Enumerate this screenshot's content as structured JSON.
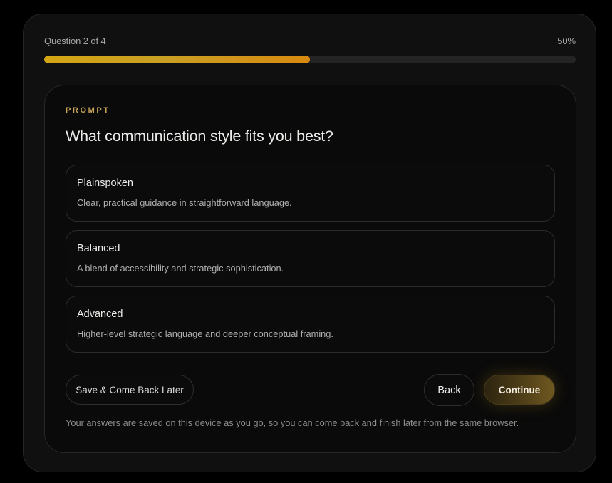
{
  "progress": {
    "label": "Question 2 of 4",
    "percent_label": "50%",
    "fraction": 0.5,
    "colors": {
      "fill_start": "#d4a514",
      "fill_end": "#d88a10",
      "track": "#242424"
    }
  },
  "question": {
    "eyebrow": "PROMPT",
    "text": "What communication style fits you best?",
    "options": [
      {
        "title": "Plainspoken",
        "description": "Clear, practical guidance in straightforward language."
      },
      {
        "title": "Balanced",
        "description": "A blend of accessibility and strategic sophistication."
      },
      {
        "title": "Advanced",
        "description": "Higher-level strategic language and deeper conceptual framing."
      }
    ]
  },
  "actions": {
    "save_label": "Save & Come Back Later",
    "back_label": "Back",
    "continue_label": "Continue"
  },
  "footnote": "Your answers are saved on this device as you go, so you can come back and finish later from the same browser.",
  "theme": {
    "accent": "#c9a55a",
    "background": "#000000",
    "card": "#101010"
  }
}
